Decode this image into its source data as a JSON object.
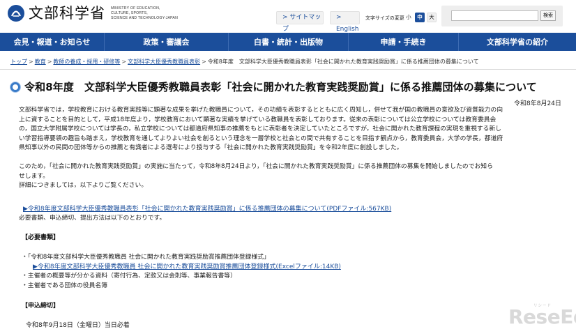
{
  "header": {
    "logo_text": "文部科学省",
    "logo_sub": [
      "MINISTRY OF EDUCATION,",
      "CULTURE, SPORTS,",
      "SCIENCE AND TECHNOLOGY-JAPAN"
    ],
    "sitemap": "> サイトマップ",
    "english": "> English",
    "fontsize_label": "文字サイズの変更",
    "fs_small": "小",
    "fs_mid": "中",
    "fs_large": "大",
    "search_placeholder": "",
    "search_button": "検索"
  },
  "nav": [
    "会見・報道・お知らせ",
    "政策・審議会",
    "白書・統計・出版物",
    "申請・手続き",
    "文部科学省の紹介"
  ],
  "breadcrumb": {
    "items": [
      "トップ",
      "教育",
      "教師の養成・採用・研修等",
      "文部科学大臣優秀教職員表彰"
    ],
    "current": "令和8年度　文部科学大臣優秀教職員表彰「社会に開かれた教育実践奨励賞」に係る推薦団体の募集について",
    "separator": ">"
  },
  "page": {
    "title": "令和8年度　文部科学大臣優秀教職員表彰「社会に開かれた教育実践奨励賞」に係る推薦団体の募集について",
    "date": "令和8年8月24日",
    "para1_lines": [
      "文部科学省では，学校教育における教育実践等に顕著な成果を挙げた教職員について，その功績を表彰するとともに広く周知し，併せて我が国の教職員の意欲及び資質能力の向",
      "上に資することを目的として，平成18年度より，学校教育において顕著な実績を挙げている教職員を表彰しております。従来の表彰については公立学校については教育委員会",
      "の，国立大学附属学校については学長の，私立学校については都道府県知事の推薦をもとに表彰者を決定していたところですが，社会に開かれた教育課程の実現を重視する新し",
      "い学習指導要領の趣旨も踏まえ，学校教育を通してよりよい社会を創るという理念を一層学校と社会との間で共有することを目指す観点から，教育委員会，大学の学長，都道府",
      "県知事以外の民間の団体等からの推薦と有識者による選考により授与する「社会に開かれた教育実践奨励賞」を令和2年度に創設しました。"
    ],
    "para2_lines": [
      "このため，「社会に開かれた教育実践奨励賞」の実施に当たって，令和8年8月24日より，「社会に開かれた教育実践奨励賞」に係る推薦団体の募集を開始しましたのでお知ら",
      "せします。",
      "詳細につきましては，以下よりご覧ください。"
    ],
    "link1": "▶令和8年度文部科学大臣優秀教職員表彰「社会に開かれた教育実践奨励賞」に係る推薦団体の募集について(PDFファイル:567KB)",
    "req_text": "必要書類、申込締切、提出方法は以下のとおりです。",
    "section_docs": "【必要書類】",
    "bullet1": "・「令和8年度文部科学大臣優秀教職員 社会に開かれた教育実践奨励賞推薦団体登録様式」",
    "link2": "▶令和8年度文部科学大臣優秀教職員 社会に開かれた教育実践奨励賞推薦団体登録様式(Excelファイル:14KB)",
    "bullet2": "・主催者の概要等が分かる資料（寄付行為、定款又は会則等、事業報告書等）",
    "bullet3": "・主催者である団体の役員名簿",
    "section_deadline": "【申込締切】",
    "deadline": "令和8年9月18日（金曜日）当日必着"
  },
  "watermark": {
    "main": "ReseEd",
    "sub": "リシード"
  },
  "colors": {
    "brand": "#1b4e9b",
    "link": "#1b4e9b",
    "title_icon": "#3a7bc8"
  }
}
